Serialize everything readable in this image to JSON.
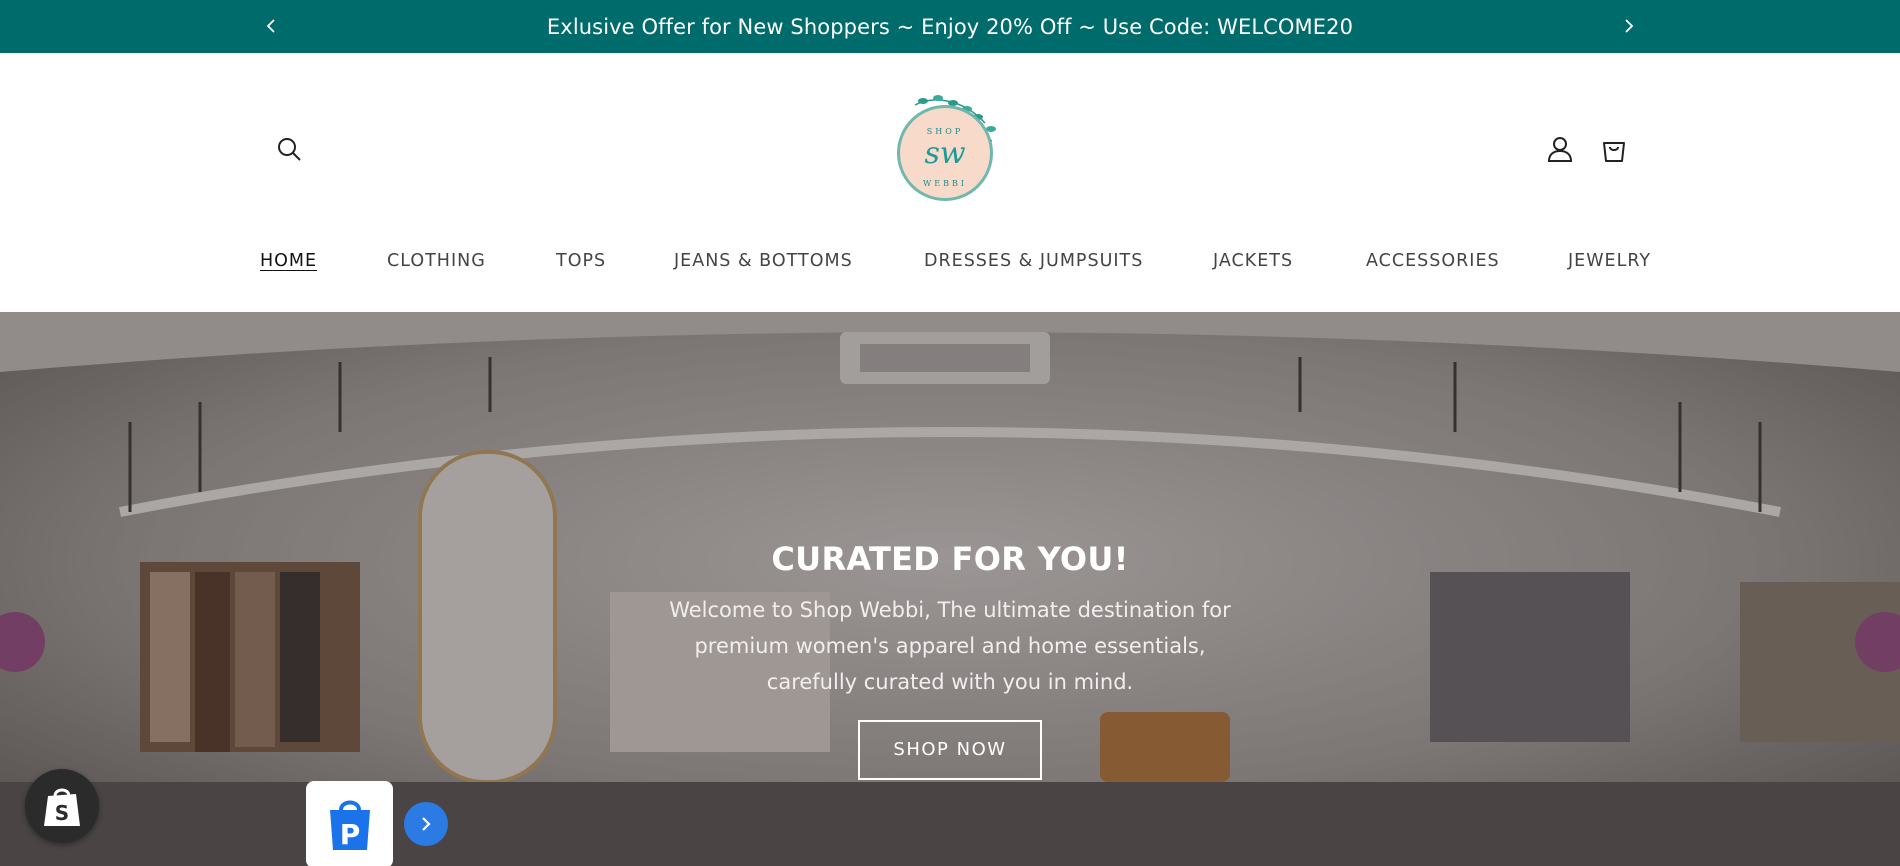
{
  "announcement": {
    "text": "Exlusive Offer for New Shoppers ~ Enjoy 20% Off ~ Use Code: WELCOME20",
    "prev_icon": "chevron-left-icon",
    "next_icon": "chevron-right-icon",
    "background": "#006b6b"
  },
  "header": {
    "logo": {
      "top": "SHOP",
      "monogram": "sw",
      "bottom": "WEBBI"
    },
    "icons": [
      "search-icon",
      "account-icon",
      "cart-icon"
    ]
  },
  "nav": {
    "items": [
      {
        "label": "HOME",
        "active": true
      },
      {
        "label": "CLOTHING"
      },
      {
        "label": "TOPS"
      },
      {
        "label": "JEANS & BOTTOMS"
      },
      {
        "label": "DRESSES & JUMPSUITS"
      },
      {
        "label": "JACKETS"
      },
      {
        "label": "ACCESSORIES"
      },
      {
        "label": "JEWELRY"
      }
    ]
  },
  "hero": {
    "title": "CURATED FOR YOU!",
    "text": "Welcome to Shop Webbi, The ultimate destination for premium women's apparel and home essentials, carefully curated with you in mind.",
    "button": "SHOP NOW"
  },
  "widgets": {
    "shopify": "shopify-bag-icon",
    "payments": "p-logo-icon",
    "arrow": "chevron-right-icon"
  }
}
